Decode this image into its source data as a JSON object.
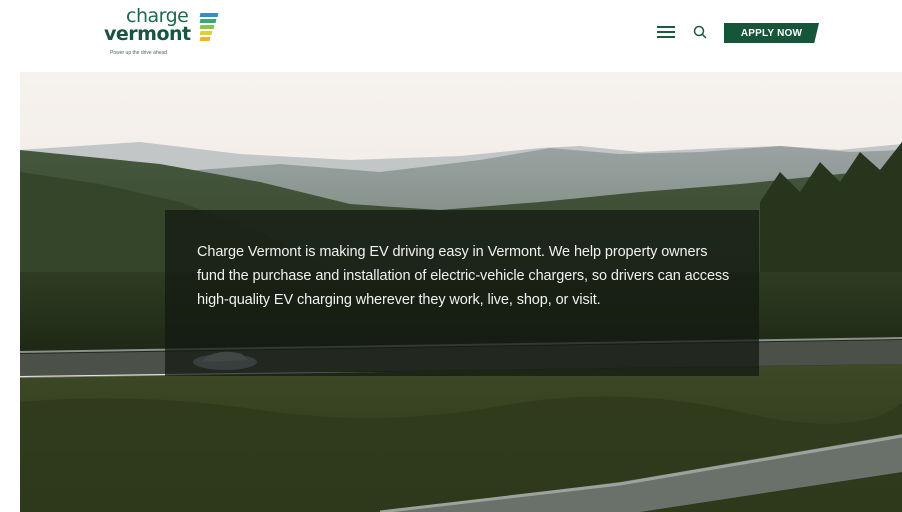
{
  "header": {
    "logo": {
      "word_top": "charge",
      "word_bottom": "vermont",
      "tagline": "Power up the drive ahead",
      "bar_colors": [
        "#2e8fd1",
        "#3aa77a",
        "#8cc63f",
        "#d9d23a",
        "#f0b429"
      ]
    },
    "menu_icon": "hamburger-menu-icon",
    "search_icon": "search-icon",
    "apply_label": "APPLY NOW",
    "brand_color": "#15553a"
  },
  "hero": {
    "text": "Charge Vermont is making EV driving easy in Vermont. We help property owners fund the purchase and installation of electric-vehicle chargers, so drivers can access high-quality EV charging wherever they work, live, shop, or visit.",
    "overlay_color": "#12180f"
  }
}
